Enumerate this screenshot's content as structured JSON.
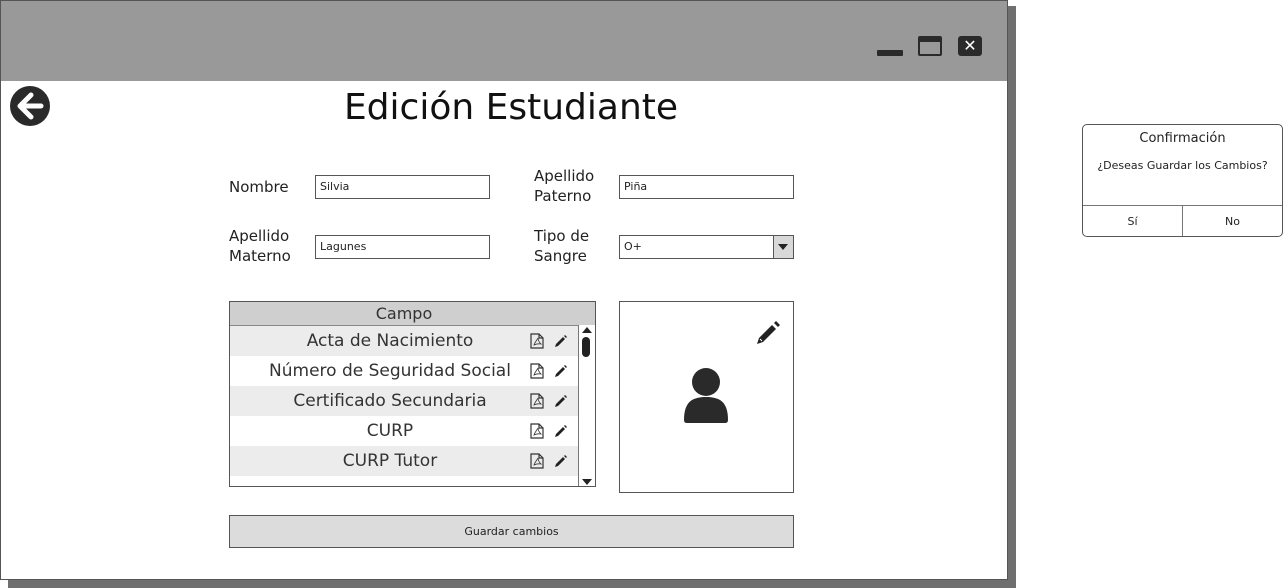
{
  "window": {
    "controls": {
      "minimize_icon": "minimize-icon",
      "maximize_icon": "maximize-icon",
      "close_icon": "close-icon"
    }
  },
  "header": {
    "title": "Edición Estudiante",
    "back_icon": "arrow-left-circle-icon"
  },
  "form": {
    "nombre": {
      "label": "Nombre",
      "value": "Silvia"
    },
    "apellido_paterno": {
      "label_line1": "Apellido",
      "label_line2": "Paterno",
      "value": "Piña"
    },
    "apellido_materno": {
      "label_line1": "Apellido",
      "label_line2": "Materno",
      "value": "Lagunes"
    },
    "tipo_sangre": {
      "label_line1": "Tipo de",
      "label_line2": "Sangre",
      "value": "O+"
    }
  },
  "documents": {
    "header": "Campo",
    "rows": [
      {
        "label": "Acta de Nacimiento"
      },
      {
        "label": "Número de Seguridad Social"
      },
      {
        "label": "Certificado Secundaria"
      },
      {
        "label": "CURP"
      },
      {
        "label": "CURP Tutor"
      }
    ],
    "row_icons": {
      "file": "pdf-file-icon",
      "edit": "pencil-icon"
    }
  },
  "photo": {
    "edit_icon": "pencil-icon",
    "placeholder_icon": "user-avatar-icon"
  },
  "save_button": {
    "label": "Guardar cambios"
  },
  "dialog": {
    "title": "Confirmación",
    "message": "¿Deseas Guardar los Cambios?",
    "yes_label": "Sí",
    "no_label": "No"
  },
  "colors": {
    "titlebar": "#999999",
    "row_shade": "#ececec",
    "button_bg": "#dcdcdc",
    "table_header": "#cfcfcf"
  }
}
